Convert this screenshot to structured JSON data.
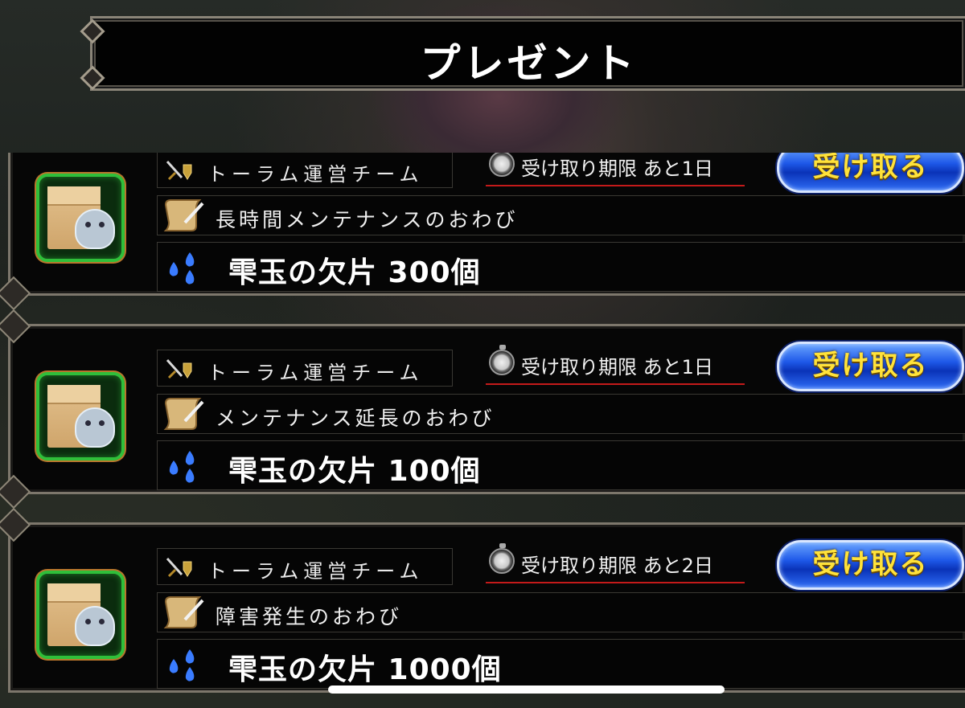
{
  "screen_title": "プレゼント",
  "claim_label": "受け取る",
  "presents": [
    {
      "sender": "トーラム運営チーム",
      "deadline": "受け取り期限 あと1日",
      "message": "長時間メンテナンスのおわび",
      "reward": "雫玉の欠片 300個"
    },
    {
      "sender": "トーラム運営チーム",
      "deadline": "受け取り期限 あと1日",
      "message": "メンテナンス延長のおわび",
      "reward": "雫玉の欠片 100個"
    },
    {
      "sender": "トーラム運営チーム",
      "deadline": "受け取り期限 あと2日",
      "message": "障害発生のおわび",
      "reward": "雫玉の欠片 1000個"
    }
  ],
  "icons": {
    "item": "cardboard-box-with-pet-icon",
    "sender": "sword-shield-icon",
    "deadline": "stopwatch-icon",
    "message": "scroll-quill-icon",
    "reward": "water-drops-icon"
  },
  "colors": {
    "claim_button": "#1e58e8",
    "claim_text": "#ffe23a",
    "deadline_underline": "#c41a1a",
    "item_frame": "#2fbf3a"
  }
}
